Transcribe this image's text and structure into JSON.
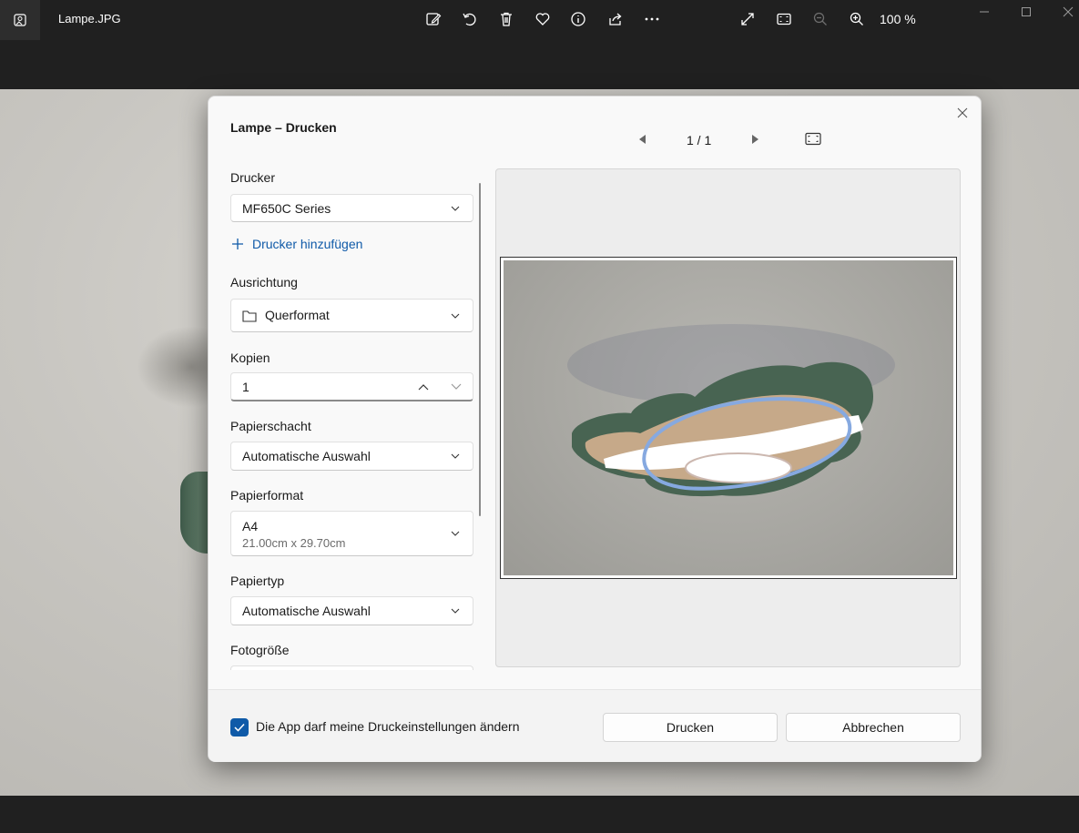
{
  "topbar": {
    "filename": "Lampe.JPG",
    "zoom": "100 %",
    "icons": [
      "edit-image-icon",
      "rotate-icon",
      "delete-icon",
      "favorite-icon",
      "info-icon",
      "share-icon",
      "more-icon",
      "fullscreen-icon",
      "fit-icon",
      "zoom-out-icon",
      "zoom-in-icon"
    ]
  },
  "dialog": {
    "title": "Lampe – Drucken",
    "printer": {
      "label": "Drucker",
      "value": "MF650C Series",
      "add_link": "Drucker hinzufügen"
    },
    "orientation": {
      "label": "Ausrichtung",
      "value": "Querformat"
    },
    "copies": {
      "label": "Kopien",
      "value": "1"
    },
    "tray": {
      "label": "Papierschacht",
      "value": "Automatische Auswahl"
    },
    "paper_size": {
      "label": "Papierformat",
      "value": "A4",
      "sub": "21.00cm x 29.70cm"
    },
    "paper_type": {
      "label": "Papiertyp",
      "value": "Automatische Auswahl"
    },
    "photo_size": {
      "label": "Fotogröße"
    },
    "preview": {
      "page_count": "1 / 1"
    },
    "footer": {
      "checkbox_label": "Die App darf meine Druckeinstellungen ändern",
      "checkbox_checked": true,
      "print_button": "Drucken",
      "cancel_button": "Abbrechen"
    }
  },
  "colors": {
    "accent": "#0f5aa8",
    "topbar": "#202020",
    "dialog": "#f9f9f9"
  }
}
